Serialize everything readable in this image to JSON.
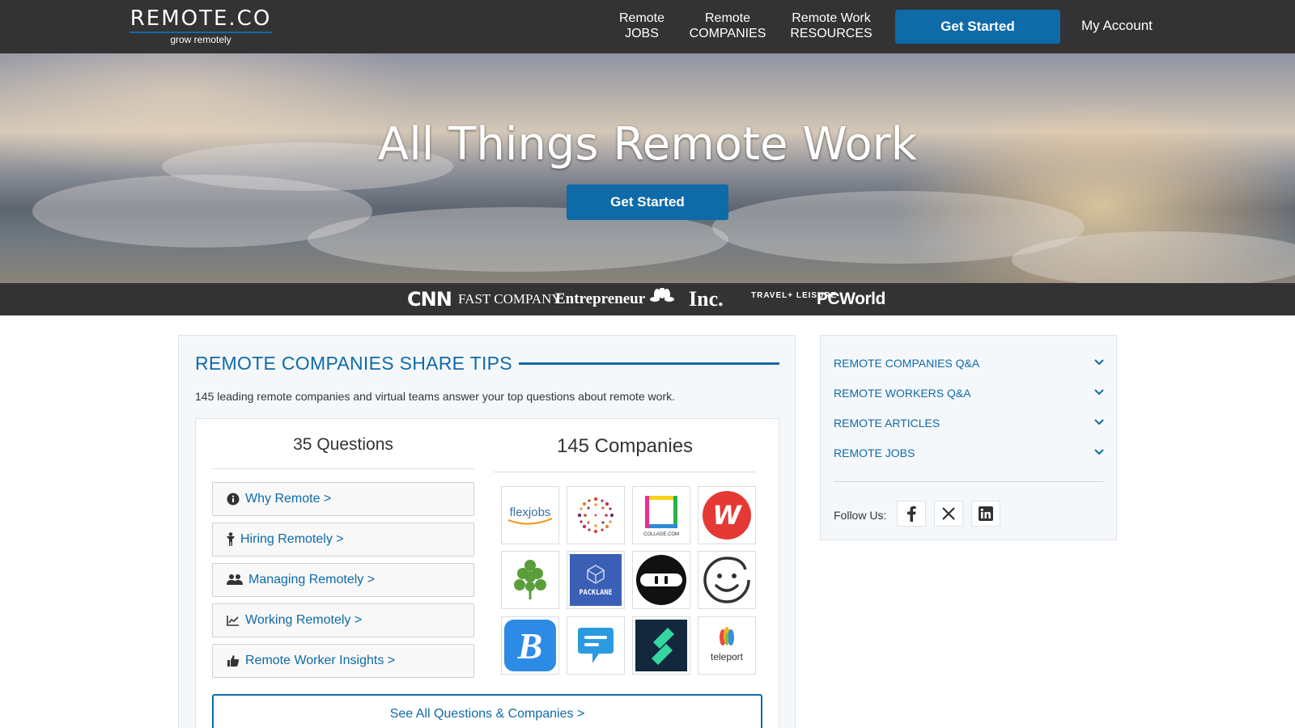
{
  "header": {
    "logo_text": "REMOTE.CO",
    "logo_tagline": "grow remotely",
    "nav": [
      {
        "line1": "Remote",
        "line2": "JOBS"
      },
      {
        "line1": "Remote",
        "line2": "COMPANIES"
      },
      {
        "line1": "Remote Work",
        "line2": "RESOURCES"
      }
    ],
    "cta_label": "Get Started",
    "account_label": "My Account"
  },
  "hero": {
    "title": "All Things Remote Work",
    "cta_label": "Get Started"
  },
  "press": [
    "CNN",
    "FAST COMPANY",
    "Entrepreneur",
    "CNBC",
    "Inc.",
    "TRAVEL+ LEISURE",
    "PCWorld"
  ],
  "main": {
    "title": "REMOTE COMPANIES SHARE TIPS",
    "description": "145 leading remote companies and virtual teams answer your top questions about remote work.",
    "questions_heading": "35 Questions",
    "companies_heading": "145 Companies",
    "questions": [
      {
        "label": "Why Remote >",
        "icon": "info-icon"
      },
      {
        "label": "Hiring Remotely >",
        "icon": "person-icon"
      },
      {
        "label": "Managing Remotely >",
        "icon": "users-icon"
      },
      {
        "label": "Working Remotely >",
        "icon": "chart-icon"
      },
      {
        "label": "Remote Worker Insights >",
        "icon": "thumbs-up-icon"
      }
    ],
    "companies": [
      {
        "name": "flexjobs",
        "text": "flexjobs"
      },
      {
        "name": "dots-burst",
        "text": ""
      },
      {
        "name": "collage",
        "text": "COLLAGE.COM"
      },
      {
        "name": "w-logo",
        "text": "W"
      },
      {
        "name": "parsley-leaf",
        "text": ""
      },
      {
        "name": "packlane",
        "text": "PACKLANE"
      },
      {
        "name": "ninja-mask",
        "text": ""
      },
      {
        "name": "smiley-face",
        "text": ""
      },
      {
        "name": "b-logo",
        "text": "B"
      },
      {
        "name": "speech-bubble",
        "text": ""
      },
      {
        "name": "slash-logo",
        "text": ""
      },
      {
        "name": "teleport",
        "text": "teleport"
      }
    ],
    "see_all_label": "See All Questions & Companies >"
  },
  "sidebar": {
    "items": [
      {
        "label": "REMOTE COMPANIES Q&A"
      },
      {
        "label": "REMOTE WORKERS Q&A"
      },
      {
        "label": "REMOTE ARTICLES"
      },
      {
        "label": "REMOTE JOBS"
      }
    ],
    "follow_label": "Follow Us:",
    "social": [
      "facebook-icon",
      "x-icon",
      "linkedin-icon"
    ]
  },
  "colors": {
    "accent": "#0f6aa8",
    "header_bg": "#333333",
    "panel_bg": "#f5f8fb"
  }
}
